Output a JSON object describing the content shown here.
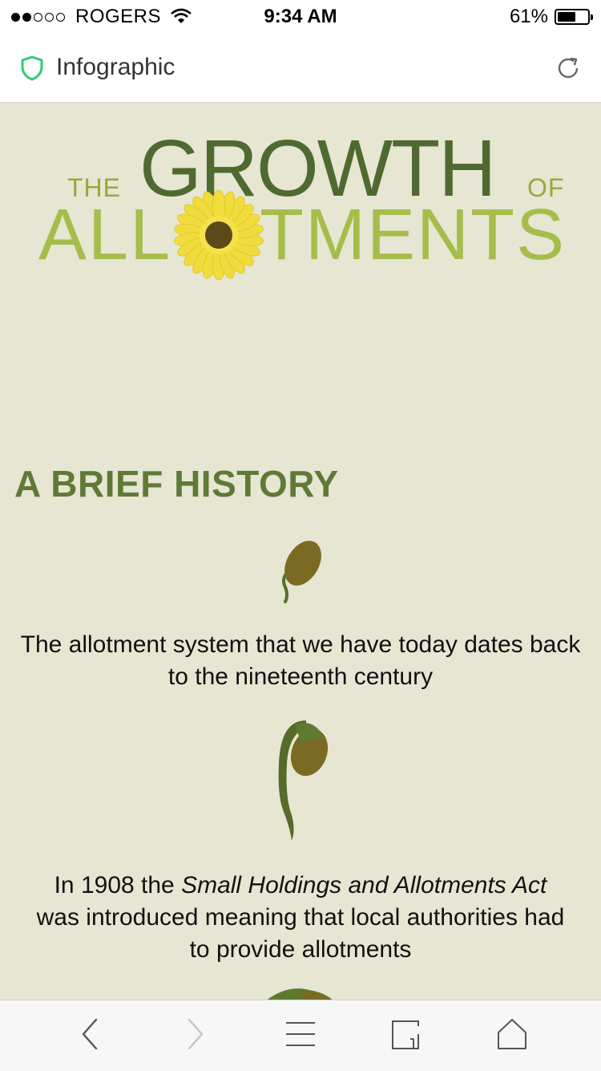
{
  "status_bar": {
    "carrier": "ROGERS",
    "time": "9:34 AM",
    "battery_percent": "61%",
    "battery_level": 0.61,
    "signal_bars": 2
  },
  "nav": {
    "title": "Infographic",
    "icons": {
      "secure": "shield-icon",
      "reload": "reload-icon"
    }
  },
  "infographic": {
    "title_the": "THE",
    "title_growth": "GROWTH",
    "title_of": "OF",
    "title_allotments_left": "ALL",
    "title_allotments_right": "TMENTS",
    "section_heading": "A BRIEF HISTORY",
    "paragraph1": "The allotment system that we have today dates back to the nineteenth century",
    "paragraph2_prefix": "In 1908 the ",
    "paragraph2_italic": "Small Holdings and Allotments Act",
    "paragraph2_line2": "was introduced meaning that local authorities had",
    "paragraph2_line3": "to provide allotments",
    "colors": {
      "background": "#e6e6d3",
      "dark_green": "#4f6a2f",
      "light_green": "#a6bd4b",
      "sunflower": "#f0dc3c",
      "seed_brown": "#7a6a24"
    }
  },
  "toolbar": {
    "icons": [
      "back-icon",
      "forward-icon",
      "menu-icon",
      "tabs-icon",
      "home-icon"
    ]
  }
}
